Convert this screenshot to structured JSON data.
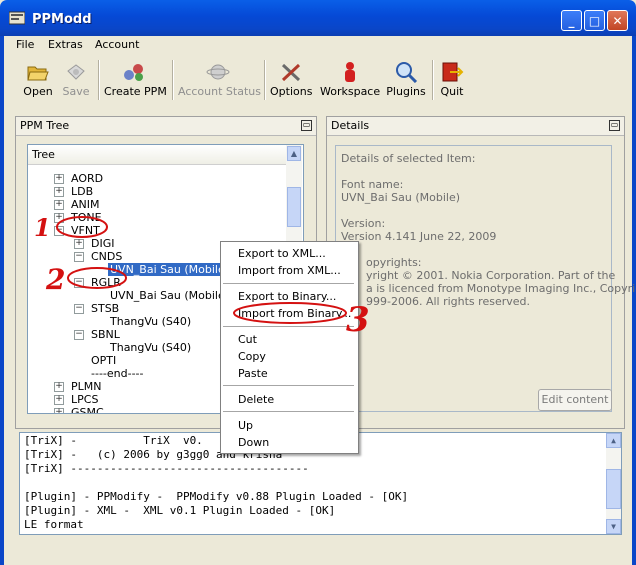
{
  "window": {
    "title": "PPModd"
  },
  "menubar": {
    "items": [
      "File",
      "Extras",
      "Account"
    ]
  },
  "toolbar": {
    "open": "Open",
    "save": "Save",
    "create_ppm": "Create PPM",
    "account_status": "Account Status",
    "options": "Options",
    "workspace": "Workspace",
    "plugins": "Plugins",
    "quit": "Quit"
  },
  "tree_panel": {
    "title": "PPM Tree",
    "header": "Tree",
    "nodes": {
      "aord": "AORD",
      "ldb": "LDB",
      "anim": "ANIM",
      "tone": "TONE",
      "vfnt": "VFNT",
      "digi": "DIGI",
      "cnds": "CNDS",
      "uvn_selected": "UVN_Bai Sau (Mobile)",
      "rglr": "RGLR",
      "uvn_rglr": "UVN_Bai Sau (Mobile)",
      "stsb": "STSB",
      "thangvu1": "ThangVu (S40)",
      "sbnl": "SBNL",
      "thangvu2": "ThangVu (S40)",
      "opti": "OPTI",
      "end": "----end----",
      "plmn": "PLMN",
      "lpcs": "LPCS",
      "gsmc": "GSMC"
    }
  },
  "details_panel": {
    "title": "Details",
    "heading": "Details of selected Item:",
    "font_label": "Font name:",
    "font_value": "UVN_Bai Sau (Mobile)",
    "version_label": "Version:",
    "version_value": "Version 4.141 June 22, 2009",
    "copyrights_label": "opyrights:",
    "copy1": "yright © 2001. Nokia Corporation.  Part of the",
    "copy2": "a is licenced from Monotype Imaging Inc., Copyright",
    "copy3": "999-2006. All rights reserved.",
    "edit_button": "Edit content"
  },
  "context_menu": {
    "export_xml": "Export to XML...",
    "import_xml": "Import from XML...",
    "export_binary": "Export to Binary...",
    "import_binary": "Import from Binary...",
    "cut": "Cut",
    "copy": "Copy",
    "paste": "Paste",
    "delete": "Delete",
    "up": "Up",
    "down": "Down"
  },
  "console": {
    "lines": [
      "[TriX] -          TriX  v0.",
      "[TriX] -   (c) 2006 by g3gg0 and krisha",
      "[TriX] ------------------------------------",
      "",
      "[Plugin] - PPModify -  PPModify v0.88 Plugin Loaded - [OK]",
      "[Plugin] - XML -  XML v0.1 Plugin Loaded - [OK]",
      "LE format"
    ]
  },
  "annotations": {
    "one": "1",
    "two": "2",
    "three": "3"
  },
  "colors": {
    "titlebar": "#0549d6",
    "selection": "#316ac5",
    "annotation": "#d41111"
  }
}
